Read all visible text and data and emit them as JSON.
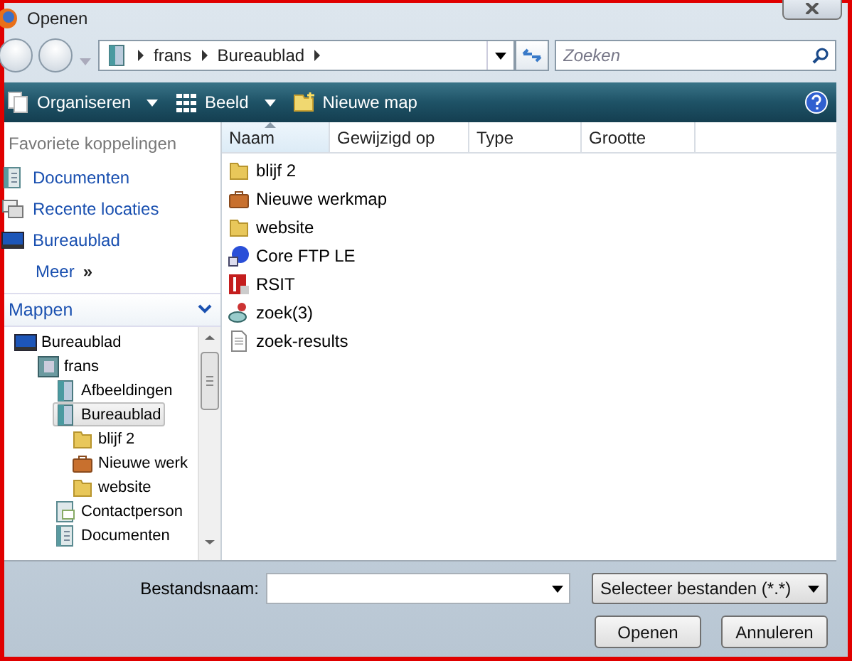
{
  "window": {
    "title": "Openen"
  },
  "address": {
    "crumbs": [
      "frans",
      "Bureaublad"
    ]
  },
  "search": {
    "placeholder": "Zoeken"
  },
  "toolbar": [
    {
      "label": "Organiseren",
      "kind": "organize",
      "dropdown": true
    },
    {
      "label": "Beeld",
      "kind": "view",
      "dropdown": true
    },
    {
      "label": "Nieuwe map",
      "kind": "newfolder",
      "dropdown": false
    }
  ],
  "favorites": {
    "heading": "Favoriete koppelingen",
    "items": [
      {
        "label": "Documenten",
        "kind": "documents"
      },
      {
        "label": "Recente locaties",
        "kind": "recent"
      },
      {
        "label": "Bureaublad",
        "kind": "desktop"
      }
    ],
    "more": "Meer",
    "more_icon": "»"
  },
  "folders": {
    "heading": "Mappen",
    "tree": [
      {
        "label": "Bureaublad",
        "kind": "desktop",
        "selected": false,
        "children": [
          {
            "label": "frans",
            "kind": "user",
            "selected": false,
            "children": [
              {
                "label": "Afbeeldingen",
                "kind": "library",
                "selected": false
              },
              {
                "label": "Bureaublad",
                "kind": "library",
                "selected": true,
                "children": [
                  {
                    "label": "blijf 2",
                    "kind": "folder",
                    "selected": false
                  },
                  {
                    "label": "Nieuwe werk",
                    "kind": "briefcase",
                    "selected": false
                  },
                  {
                    "label": "website",
                    "kind": "folder",
                    "selected": false
                  }
                ]
              },
              {
                "label": "Contactperson",
                "kind": "contacts",
                "selected": false
              },
              {
                "label": "Documenten",
                "kind": "documents",
                "selected": false
              }
            ]
          }
        ]
      }
    ]
  },
  "columns": [
    {
      "label": "Naam",
      "sorted": true
    },
    {
      "label": "Gewijzigd op",
      "sorted": false
    },
    {
      "label": "Type",
      "sorted": false
    },
    {
      "label": "Grootte",
      "sorted": false
    }
  ],
  "files": [
    {
      "name": "blijf 2",
      "kind": "folder"
    },
    {
      "name": "Nieuwe werkmap",
      "kind": "briefcase"
    },
    {
      "name": "website",
      "kind": "folder"
    },
    {
      "name": "Core FTP LE",
      "kind": "app"
    },
    {
      "name": "RSIT",
      "kind": "rsit"
    },
    {
      "name": "zoek(3)",
      "kind": "search"
    },
    {
      "name": "zoek-results",
      "kind": "file"
    }
  ],
  "footer": {
    "filename_label": "Bestandsnaam:",
    "filter": "Selecteer bestanden (*.*)",
    "buttons": [
      "Openen",
      "Annuleren"
    ]
  }
}
